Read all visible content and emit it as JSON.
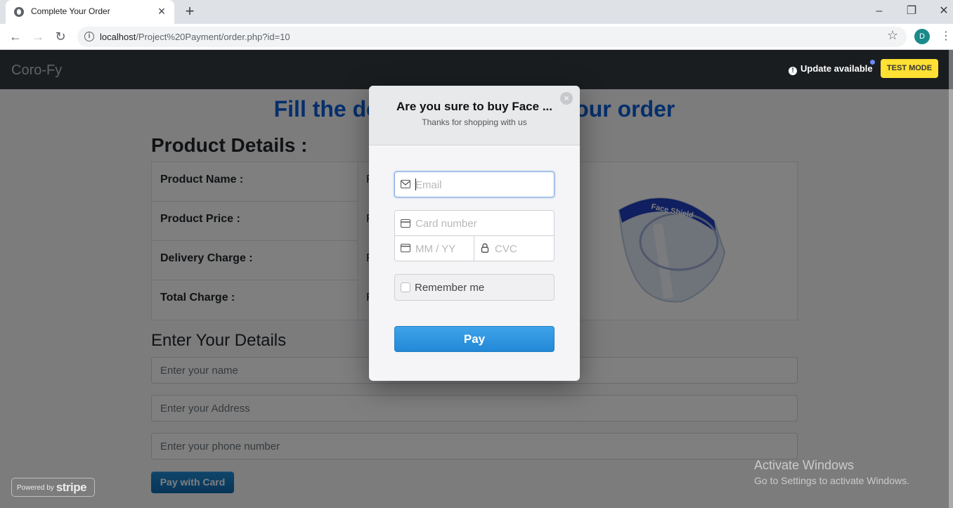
{
  "browser": {
    "tab_title": "Complete Your Order",
    "url_host": "localhost",
    "url_path": "/Project%20Payment/order.php?id=10",
    "profile_initial": "D"
  },
  "site": {
    "brand": "Coro-Fy",
    "update_text": "Update available",
    "test_mode": "TEST MODE"
  },
  "page": {
    "heading": "Fill the details to complete your order",
    "product_heading": "Product Details :",
    "product_rows": [
      {
        "label": "Product Name :",
        "value": "F"
      },
      {
        "label": "Product Price :",
        "value": "F"
      },
      {
        "label": "Delivery Charge :",
        "value": "F"
      },
      {
        "label": "Total Charge :",
        "value": "F"
      }
    ],
    "enter_heading": "Enter Your Details",
    "name_placeholder": "Enter your name",
    "address_placeholder": "Enter your Address",
    "phone_placeholder": "Enter your phone number",
    "pay_with_card": "Pay with Card"
  },
  "stripe": {
    "powered_by": "Powered by",
    "stripe_word": "stripe"
  },
  "windows": {
    "line1": "Activate Windows",
    "line2": "Go to Settings to activate Windows."
  },
  "modal": {
    "title": "Are you sure to buy Face ...",
    "subtitle": "Thanks for shopping with us",
    "email_placeholder": "Email",
    "card_placeholder": "Card number",
    "expiry_placeholder": "MM / YY",
    "cvc_placeholder": "CVC",
    "remember_label": "Remember me",
    "pay_label": "Pay"
  },
  "colors": {
    "heading_blue": "#0b5ed7",
    "navbar": "#343a40",
    "test_mode_yellow": "#ffe033",
    "pay_blue": "#2388d6"
  }
}
